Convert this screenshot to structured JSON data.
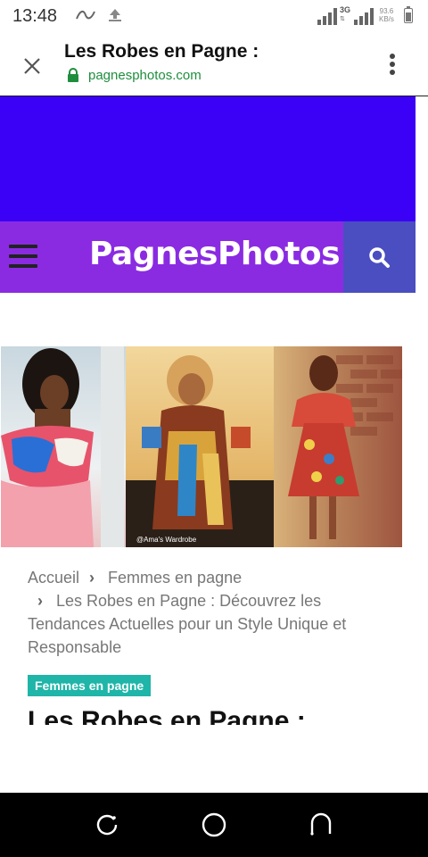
{
  "status_bar": {
    "time": "13:48",
    "network_type": "3G",
    "speed_value": "93.6",
    "speed_unit": "KB/s",
    "icons": [
      "activity-icon",
      "upload-icon",
      "signal-icon",
      "signal-icon",
      "battery-icon"
    ]
  },
  "app_bar": {
    "title": "Les Robes en Pagne :",
    "url": "pagnesphotos.com"
  },
  "site_nav": {
    "logo": "PagnesPhotos",
    "menu_icon": "hamburger-icon",
    "search_icon": "search-icon",
    "banner_color": "#3b00f6",
    "nav_color": "#8a2be2",
    "search_color": "#4a4ec0"
  },
  "hero": {
    "credit": "@Ama's Wardrobe"
  },
  "breadcrumb": {
    "home": "Accueil",
    "category": "Femmes en pagne",
    "current": "Les Robes en Pagne : Découvrez les Tendances Actuelles pour un Style Unique et Responsable"
  },
  "article": {
    "category_badge": "Femmes en pagne",
    "badge_color": "#1fb5a8",
    "title": "Les Robes en Pagne :"
  },
  "system_nav": {
    "icons": [
      "recent-apps-icon",
      "home-icon",
      "back-icon"
    ]
  }
}
